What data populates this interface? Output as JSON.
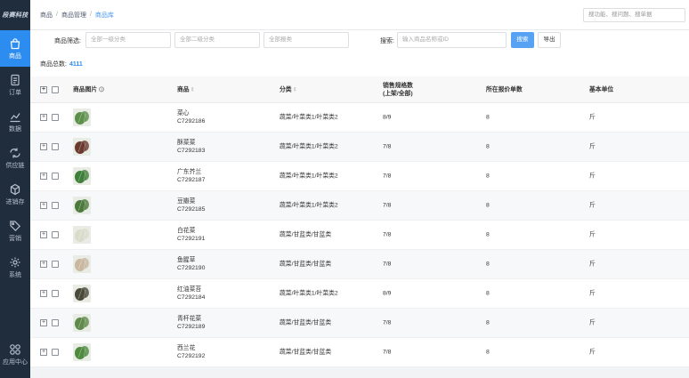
{
  "brand": "段赛科技",
  "nav": [
    {
      "label": "商品",
      "icon": "bag-icon",
      "active": true
    },
    {
      "label": "订单",
      "icon": "order-icon"
    },
    {
      "label": "数据",
      "icon": "chart-icon"
    },
    {
      "label": "供应链",
      "icon": "supply-chain-icon"
    },
    {
      "label": "进销存",
      "icon": "inventory-icon"
    },
    {
      "label": "营销",
      "icon": "tag-icon"
    },
    {
      "label": "系统",
      "icon": "gear-icon"
    }
  ],
  "nav_bottom": {
    "label": "应用中心",
    "icon": "apps-icon"
  },
  "breadcrumb": [
    "商品",
    "商品管理",
    "商品库"
  ],
  "top_search": {
    "placeholder": "搜功能、搜问题、搜单据"
  },
  "filters": {
    "label": "商品筛选:",
    "cat1_placeholder": "全部一级分类",
    "cat2_placeholder": "全部二级分类",
    "type_placeholder": "全部报类",
    "search_label": "搜索:",
    "search_placeholder": "输入商品名称或ID",
    "search_button": "搜索",
    "export_button": "导出"
  },
  "total": {
    "label": "商品总数:",
    "value": "4111"
  },
  "table": {
    "headers": {
      "image": "商品图片",
      "product": "商品",
      "category": "分类",
      "spec_line1": "销售规格数",
      "spec_line2": "(上架/全部)",
      "quote": "所在报价单数",
      "unit": "基本单位"
    },
    "rows": [
      {
        "name": "菜心",
        "id": "C7292186",
        "category": "蔬菜/叶菜类1/叶菜类2",
        "spec": "8/9",
        "quote": "8",
        "unit": "斤",
        "thumb": "#5b8f4a"
      },
      {
        "name": "酥菜菜",
        "id": "C7292183",
        "category": "蔬菜/叶菜类1/叶菜类2",
        "spec": "7/8",
        "quote": "8",
        "unit": "斤",
        "thumb": "#6b3a2f"
      },
      {
        "name": "广东芥兰",
        "id": "C7292187",
        "category": "蔬菜/叶菜类1/叶菜类2",
        "spec": "7/8",
        "quote": "8",
        "unit": "斤",
        "thumb": "#3f7f3a"
      },
      {
        "name": "豆瓣菜",
        "id": "C7292185",
        "category": "蔬菜/叶菜类1/叶菜类2",
        "spec": "7/8",
        "quote": "8",
        "unit": "斤",
        "thumb": "#4c7a3c"
      },
      {
        "name": "白花菜",
        "id": "C7292191",
        "category": "蔬菜/甘蓝类/甘蓝类",
        "spec": "7/8",
        "quote": "8",
        "unit": "斤",
        "thumb": "#d9dccb"
      },
      {
        "name": "鱼腥草",
        "id": "C7292190",
        "category": "蔬菜/甘蓝类/甘蓝类",
        "spec": "7/8",
        "quote": "8",
        "unit": "斤",
        "thumb": "#c9b7a0"
      },
      {
        "name": "红油菜苔",
        "id": "C7292184",
        "category": "蔬菜/叶菜类1/叶菜类2",
        "spec": "8/9",
        "quote": "8",
        "unit": "斤",
        "thumb": "#4a4a3a"
      },
      {
        "name": "青杆花菜",
        "id": "C7292189",
        "category": "蔬菜/甘蓝类/甘蓝类",
        "spec": "7/8",
        "quote": "8",
        "unit": "斤",
        "thumb": "#5f8a4b"
      },
      {
        "name": "西兰花",
        "id": "C7292192",
        "category": "蔬菜/甘蓝类/甘蓝类",
        "spec": "7/8",
        "quote": "8",
        "unit": "斤",
        "thumb": "#4f8a3e"
      }
    ]
  },
  "colors": {
    "sidebar": "#1f2d3d",
    "accent": "#2d8cf0",
    "primary_button": "#57a3f3"
  }
}
